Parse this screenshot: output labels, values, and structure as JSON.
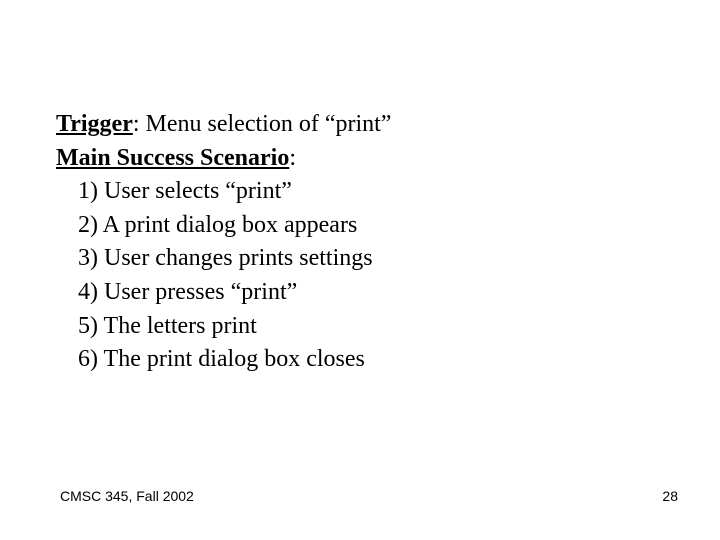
{
  "body": {
    "trigger_label": "Trigger",
    "trigger_value": ": Menu selection of “print”",
    "scenario_label": "Main Success Scenario",
    "scenario_colon": ":",
    "steps": {
      "s1": "1) User selects “print”",
      "s2": "2) A print dialog box appears",
      "s3": "3) User changes prints settings",
      "s4": "4) User presses “print”",
      "s5": "5) The letters print",
      "s6": "6) The print dialog box closes"
    }
  },
  "footer": {
    "course": "CMSC 345, Fall 2002",
    "page": "28"
  }
}
